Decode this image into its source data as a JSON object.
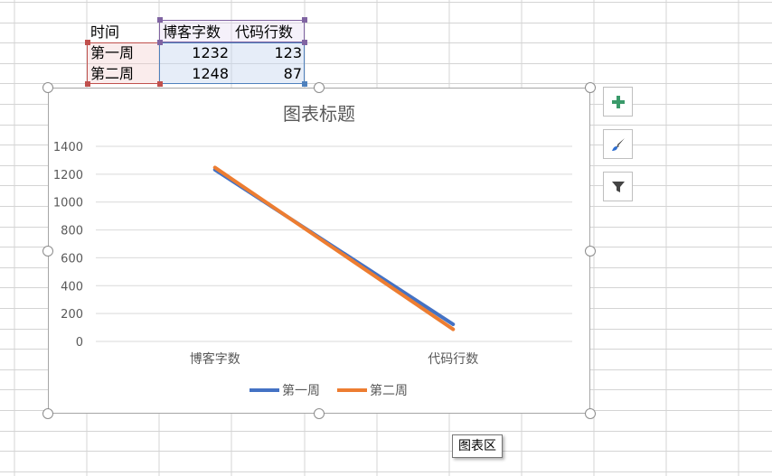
{
  "sheet": {
    "header_row": {
      "label": "时间",
      "col1": "博客字数",
      "col2": "代码行数"
    },
    "rows": [
      {
        "label": "第一周",
        "col1": "1232",
        "col2": "123"
      },
      {
        "label": "第二周",
        "col1": "1248",
        "col2": "87"
      }
    ]
  },
  "chart_buttons": {
    "add_element": "chart-elements-plus-icon",
    "style": "chart-styles-brush-icon",
    "filter": "chart-filters-funnel-icon"
  },
  "tooltip": "图表区",
  "chart_data": {
    "type": "line",
    "title": "图表标题",
    "categories": [
      "博客字数",
      "代码行数"
    ],
    "series": [
      {
        "name": "第一周",
        "values": [
          1232,
          123
        ],
        "color": "#4472c4"
      },
      {
        "name": "第二周",
        "values": [
          1248,
          87
        ],
        "color": "#ed7d31"
      }
    ],
    "ylim": [
      0,
      1400
    ],
    "yticks": [
      "0",
      "200",
      "400",
      "600",
      "800",
      "1000",
      "1200",
      "1400"
    ],
    "grid": true,
    "legend": "bottom"
  }
}
